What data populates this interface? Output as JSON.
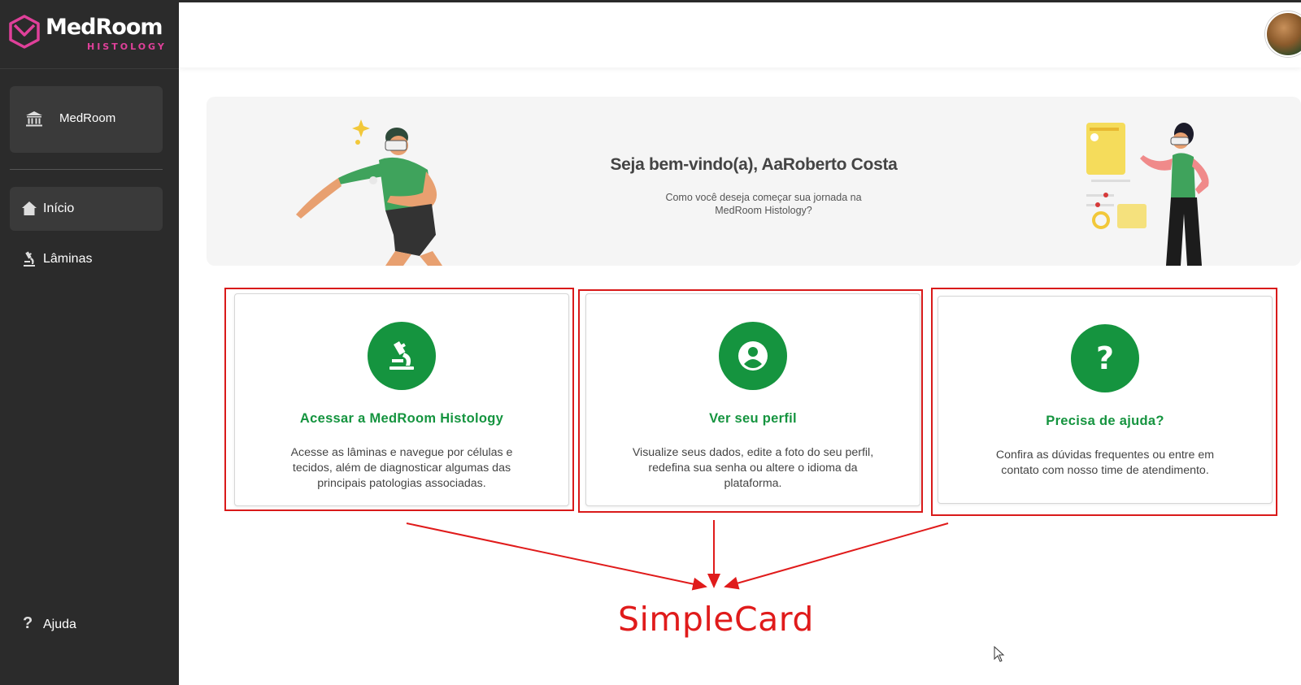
{
  "brand": {
    "name": "MedRoom",
    "product": "HISTOLOGY",
    "accent": "#e0409a"
  },
  "sidebar": {
    "org": {
      "label": "MedRoom",
      "icon": "institution-icon"
    },
    "items": [
      {
        "label": "Início",
        "icon": "home-icon",
        "active": true
      },
      {
        "label": "Lâminas",
        "icon": "microscope-icon",
        "active": false
      }
    ],
    "help": {
      "label": "Ajuda",
      "icon": "question-icon"
    }
  },
  "banner": {
    "title": "Seja bem-vindo(a), AaRoberto Costa",
    "subtitle": "Como você deseja começar sua jornada na MedRoom Histology?"
  },
  "cards": [
    {
      "title": "Acessar a MedRoom Histology",
      "description": "Acesse as lâminas e navegue por células e tecidos, além de diagnosticar algumas das principais patologias associadas.",
      "icon": "microscope-icon"
    },
    {
      "title": "Ver seu perfil",
      "description": "Visualize seus dados, edite a foto do seu perfil, redefina sua senha ou altere o idioma da plataforma.",
      "icon": "user-circle-icon"
    },
    {
      "title": "Precisa de ajuda?",
      "description": "Confira as dúvidas frequentes ou entre em contato com nosso time de atendimento.",
      "icon": "question-icon"
    }
  ],
  "annotation": {
    "label": "SimpleCard",
    "color": "#e01b1b"
  },
  "colors": {
    "sidebar_bg": "#2b2b2b",
    "primary_green": "#15943f"
  }
}
